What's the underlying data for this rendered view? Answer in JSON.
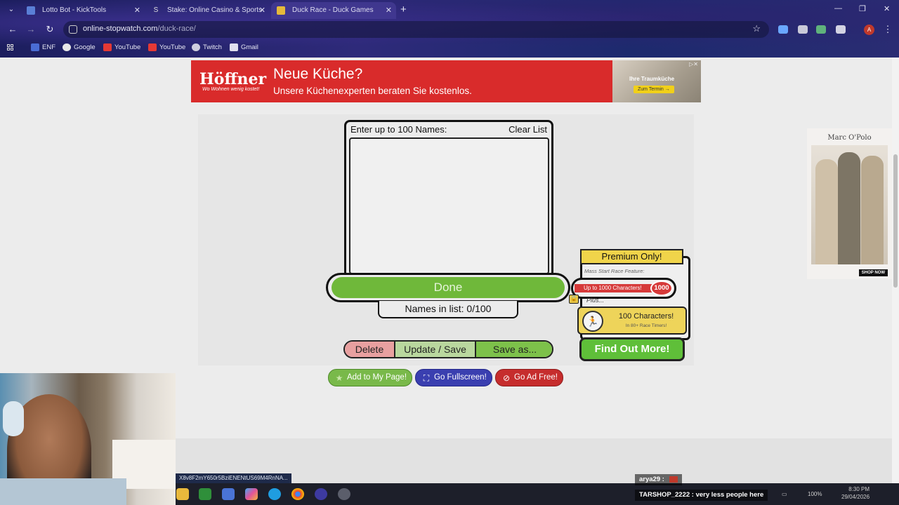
{
  "browser": {
    "tabs": [
      {
        "title": "Lotto Bot - KickTools",
        "active": false
      },
      {
        "title": "Stake: Online Casino & Sports",
        "active": false
      },
      {
        "title": "Duck Race - Duck Games",
        "active": true
      }
    ],
    "url_host": "online-stopwatch.com",
    "url_path": "/duck-race/",
    "profile_initial": "A",
    "bookmarks": [
      "ENF",
      "Google",
      "YouTube",
      "YouTube",
      "Twitch",
      "Gmail"
    ]
  },
  "ad_top": {
    "logo": "Höffner",
    "slogan": "Wo Wohnen wenig kostet!",
    "headline": "Neue Küche?",
    "subline": "Unsere Küchenexperten beraten Sie kostenlos.",
    "photo_caption": "Ihre Traumküche",
    "cta": "Zum Termin →"
  },
  "ad_side": {
    "brand": "Marc O'Polo",
    "shop": "SHOP NOW"
  },
  "names_panel": {
    "title": "Enter up to 100 Names:",
    "clear": "Clear List",
    "done": "Done",
    "count": "Names in list: 0/100"
  },
  "actions": {
    "delete": "Delete",
    "update": "Update / Save",
    "save_as": "Save as..."
  },
  "premium": {
    "header": "Premium Only!",
    "mass": "Mass Start Race Feature:",
    "bar_text": "Up to 1000 Characters!",
    "bar_number": "1000",
    "plus": "Plus...",
    "chars": "100 Characters!",
    "chars_sub": "In 80+ Race Timers!",
    "find": "Find Out More!"
  },
  "bottom_buttons": {
    "add": "Add to My Page!",
    "fullscreen": "Go Fullscreen!",
    "adfree": "Go Ad Free!"
  },
  "status_url": "X8v8F2mY650r5BziENENtUS69M4RnNA...",
  "chat": [
    {
      "user": "arya29 :",
      "msg": ""
    },
    {
      "user": "TARSHOP_2222 :",
      "msg": "very less people here"
    }
  ],
  "clock": {
    "time": "8:30 PM",
    "date": "29/04/2026"
  },
  "tray_battery": "100%",
  "colors": {
    "done_green": "#6fb83a",
    "find_green": "#5fbf39",
    "premium_yellow": "#f0d44a",
    "ad_red": "#d92b2b",
    "delete_pink": "#e8a0a0",
    "pill_green": "#79b94a",
    "pill_blue": "#3a3fb0",
    "pill_red": "#c62d2d"
  }
}
